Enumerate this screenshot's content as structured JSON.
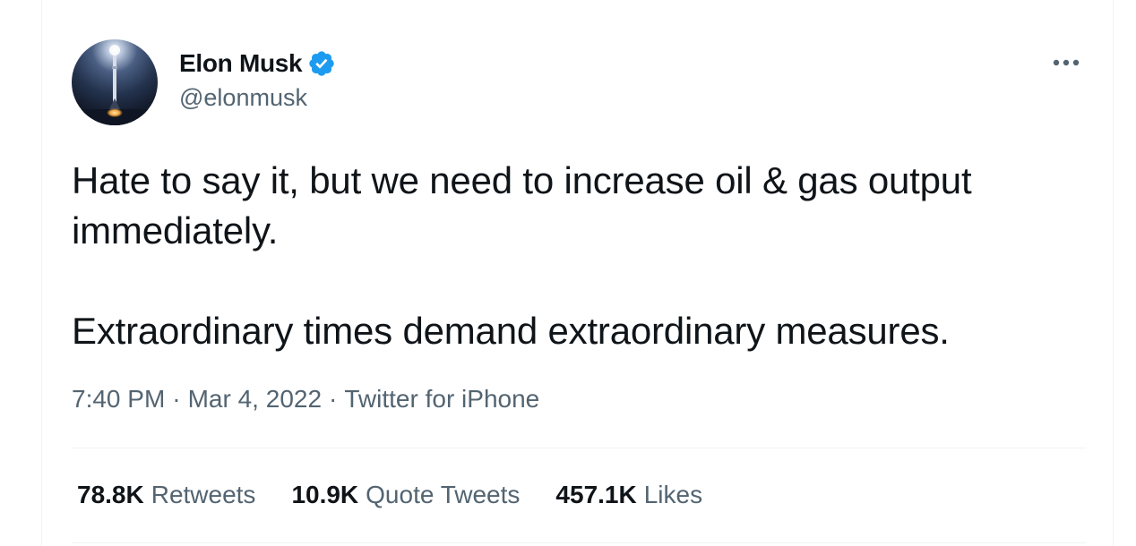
{
  "author": {
    "display_name": "Elon Musk",
    "handle": "@elonmusk",
    "verified": true,
    "avatar_icon": "rocket-launch-avatar",
    "verified_icon": "verified-badge-icon",
    "verified_color": "#1d9bf0"
  },
  "menu": {
    "more_icon": "more-horizontal-icon"
  },
  "tweet": {
    "paragraphs": [
      "Hate to say it, but we need to increase oil & gas output immediately.",
      "Extraordinary times demand extraordinary measures."
    ],
    "time": "7:40 PM",
    "date": "Mar 4, 2022",
    "source": "Twitter for iPhone",
    "separator": "·"
  },
  "stats": {
    "retweets_count": "78.8K",
    "retweets_label": "Retweets",
    "quotes_count": "10.9K",
    "quotes_label": "Quote Tweets",
    "likes_count": "457.1K",
    "likes_label": "Likes"
  },
  "colors": {
    "text_primary": "#0f1419",
    "text_secondary": "#536471",
    "divider": "#eff3f4"
  }
}
